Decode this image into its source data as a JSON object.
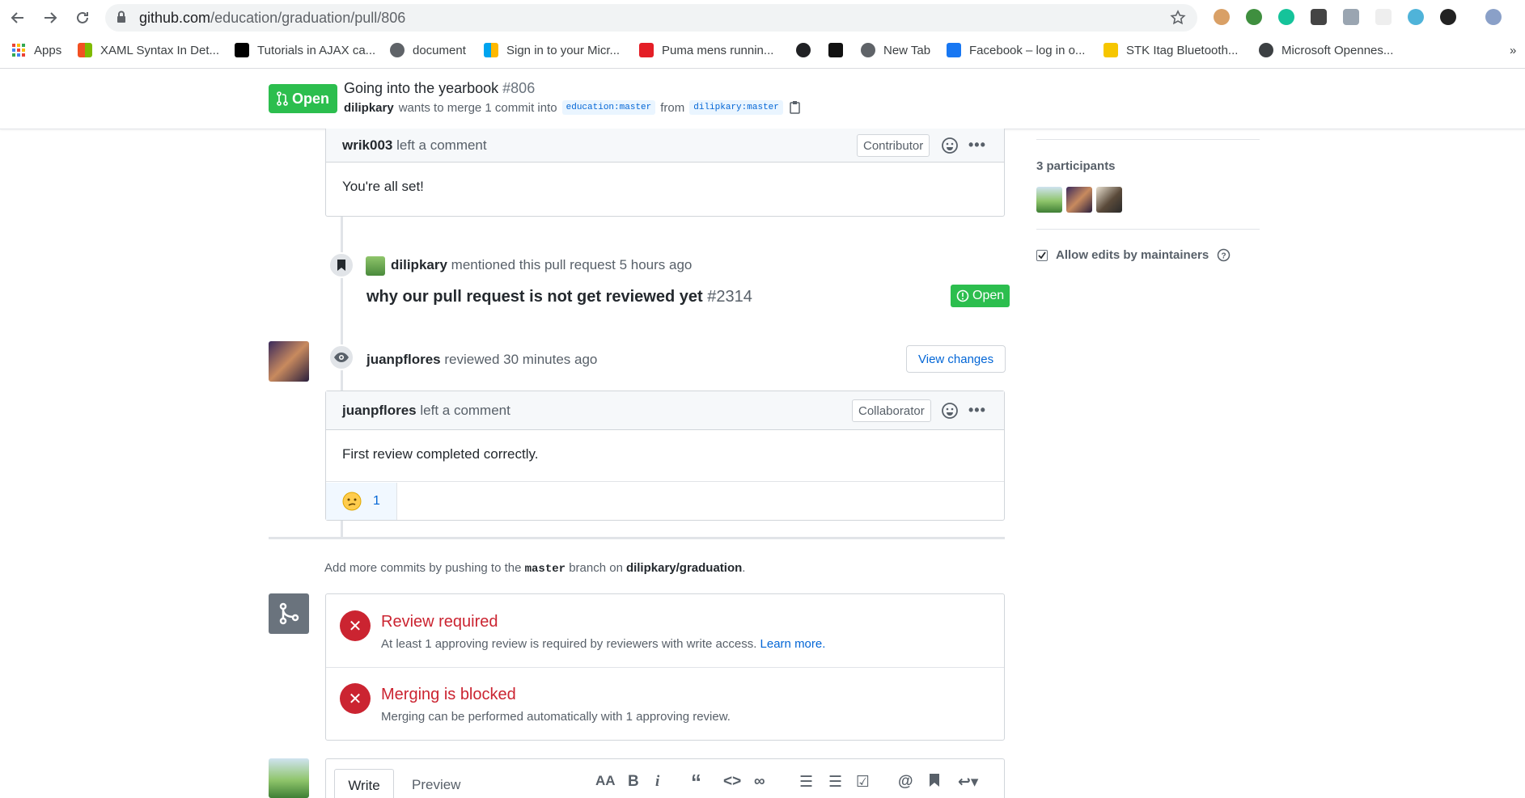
{
  "browser": {
    "url_host": "github.com",
    "url_path": "/education/graduation/pull/806",
    "bookmarks": [
      {
        "label": "Apps",
        "color": "#ea4335"
      },
      {
        "label": "XAML Syntax In Det...",
        "color": "#f25022"
      },
      {
        "label": "Tutorials in AJAX ca...",
        "color": "#000000"
      },
      {
        "label": "document",
        "color": "#5f6368"
      },
      {
        "label": "Sign in to your Micr...",
        "color": "#00a4ef"
      },
      {
        "label": "Puma mens runnin...",
        "color": "#e41e26"
      },
      {
        "label": "",
        "color": "#202124"
      },
      {
        "label": "",
        "color": "#111111"
      },
      {
        "label": "New Tab",
        "color": "#5f6368"
      },
      {
        "label": "Facebook – log in o...",
        "color": "#1877f2"
      },
      {
        "label": "STK Itag Bluetooth...",
        "color": "#f6c600"
      },
      {
        "label": "Microsoft Opennes...",
        "color": "#3c4043"
      }
    ]
  },
  "pr": {
    "state": "Open",
    "title": "Going into the yearbook",
    "number": "#806",
    "author": "dilipkary",
    "meta_mid": "wants to merge 1 commit into",
    "base_branch": "education:master",
    "from_word": "from",
    "head_branch": "dilipkary:master"
  },
  "comment1": {
    "author": "wrik003",
    "action": "left a comment",
    "role": "Contributor",
    "body": "You're all set!"
  },
  "mention": {
    "author": "dilipkary",
    "text": "mentioned this pull request",
    "time": "5 hours ago",
    "ref_title": "why our pull request is not get reviewed yet",
    "ref_number": "#2314",
    "ref_state": "Open"
  },
  "review": {
    "author": "juanpflores",
    "action": "reviewed",
    "time": "30 minutes ago",
    "button": "View changes",
    "comment_author": "juanpflores",
    "comment_action": "left a comment",
    "role": "Collaborator",
    "body": "First review completed correctly.",
    "reaction_count": "1"
  },
  "merge": {
    "hint_pre": "Add more commits by pushing to the",
    "hint_branch": "master",
    "hint_mid": "branch on",
    "hint_repo": "dilipkary/graduation",
    "hint_end": ".",
    "checks": [
      {
        "title": "Review required",
        "desc": "At least 1 approving review is required by reviewers with write access.",
        "link": "Learn more."
      },
      {
        "title": "Merging is blocked",
        "desc": "Merging can be performed automatically with 1 approving review.",
        "link": ""
      }
    ]
  },
  "sidebar": {
    "participants": "3 participants",
    "allow_edits": "Allow edits by maintainers"
  },
  "composer": {
    "tab_write": "Write",
    "tab_preview": "Preview"
  },
  "colors": {
    "green": "#2cbe4e",
    "red": "#cb2431",
    "link": "#0366d6"
  }
}
